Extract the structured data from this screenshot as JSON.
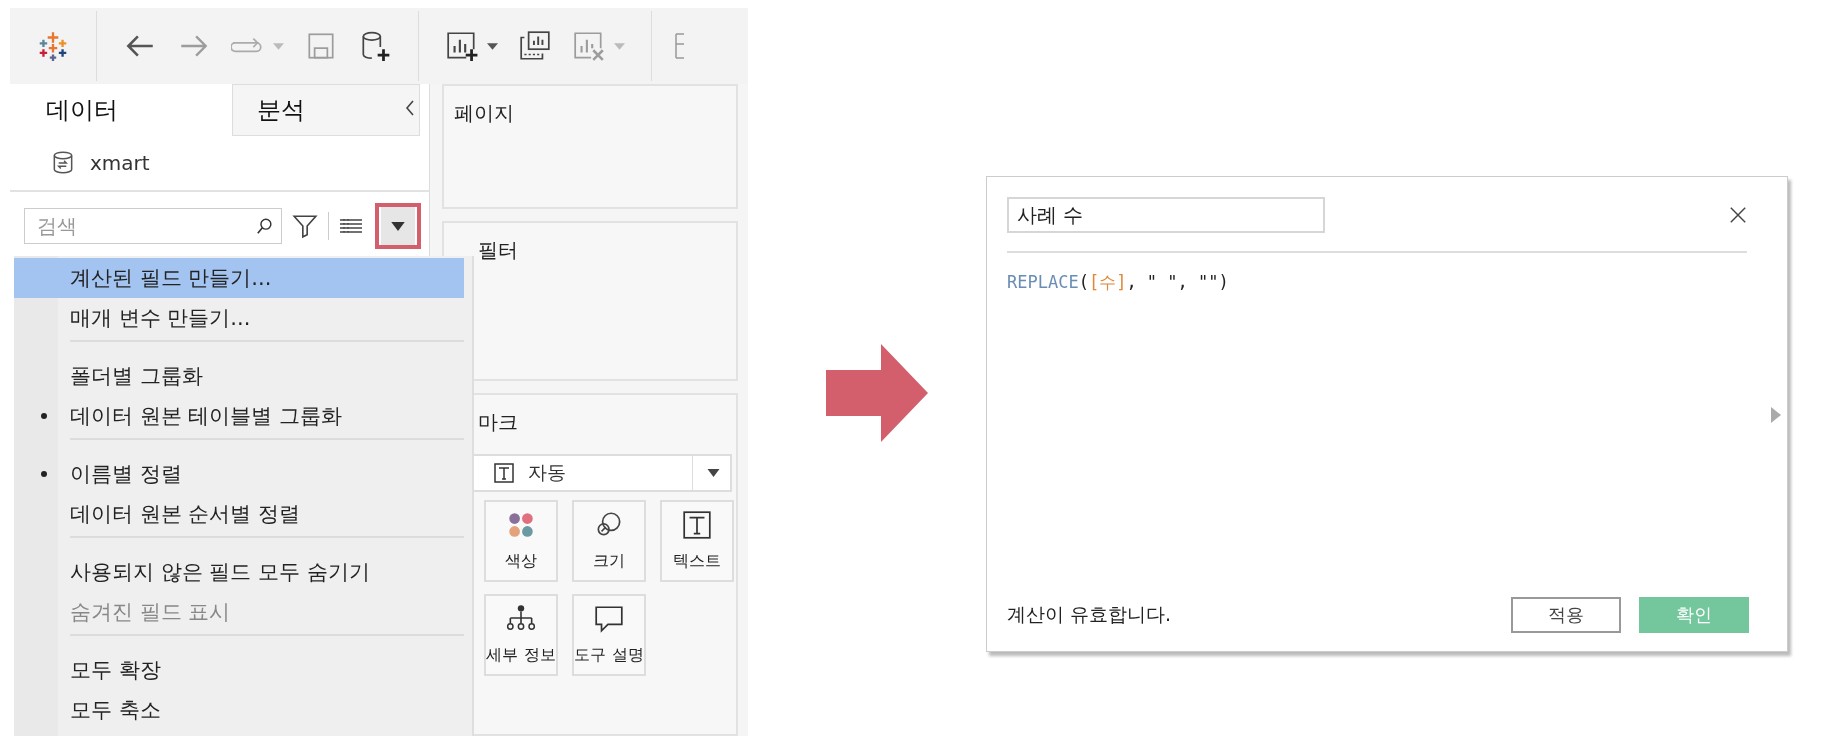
{
  "toolbar": [
    {
      "kind": "logo",
      "disabled": false,
      "caret": false
    },
    {
      "kind": "back",
      "disabled": false,
      "caret": false
    },
    {
      "kind": "forward",
      "disabled": true,
      "caret": false
    },
    {
      "kind": "redo",
      "disabled": true,
      "caret": true
    },
    {
      "kind": "save",
      "disabled": true,
      "caret": false
    },
    {
      "kind": "new-datasource",
      "disabled": false,
      "caret": false
    },
    {
      "kind": "new-sheet",
      "disabled": false,
      "caret": true
    },
    {
      "kind": "duplicate-sheet",
      "disabled": false,
      "caret": false
    },
    {
      "kind": "clear-sheet",
      "disabled": true,
      "caret": true
    }
  ],
  "side_tabs": [
    {
      "label": "데이터",
      "selected": true
    },
    {
      "label": "분석",
      "selected": false
    }
  ],
  "datasource": "xmart",
  "search": {
    "placeholder": "검색"
  },
  "menu": {
    "groups": [
      [
        {
          "label": "계산된 필드 만들기...",
          "selected": true,
          "checked": false,
          "disabled": false
        },
        {
          "label": "매개 변수 만들기...",
          "selected": false,
          "checked": false,
          "disabled": false
        }
      ],
      [
        {
          "label": "폴더별 그룹화",
          "selected": false,
          "checked": false,
          "disabled": false
        },
        {
          "label": "데이터 원본 테이블별 그룹화",
          "selected": false,
          "checked": true,
          "disabled": false
        }
      ],
      [
        {
          "label": "이름별 정렬",
          "selected": false,
          "checked": true,
          "disabled": false
        },
        {
          "label": "데이터 원본 순서별 정렬",
          "selected": false,
          "checked": false,
          "disabled": false
        }
      ],
      [
        {
          "label": "사용되지 않은 필드 모두 숨기기",
          "selected": false,
          "checked": false,
          "disabled": false
        },
        {
          "label": "숨겨진 필드 표시",
          "selected": false,
          "checked": false,
          "disabled": true
        }
      ],
      [
        {
          "label": "모두 확장",
          "selected": false,
          "checked": false,
          "disabled": false
        },
        {
          "label": "모두 축소",
          "selected": false,
          "checked": false,
          "disabled": false
        }
      ]
    ]
  },
  "cards": {
    "pages": "페이지",
    "filters": "필터",
    "marks": "마크"
  },
  "mark_type": "자동",
  "mark_tiles": [
    {
      "kind": "color",
      "label": "색상"
    },
    {
      "kind": "size",
      "label": "크기"
    },
    {
      "kind": "text",
      "label": "텍스트"
    },
    {
      "kind": "detail",
      "label": "세부 정보"
    },
    {
      "kind": "tooltip",
      "label": "도구 설명"
    }
  ],
  "dialog": {
    "name": "사례 수",
    "formula": [
      {
        "kind": "function",
        "text": "REPLACE"
      },
      {
        "kind": "plain",
        "text": "("
      },
      {
        "kind": "field",
        "text": "[수]"
      },
      {
        "kind": "plain",
        "text": ", \" \", \"\")"
      }
    ],
    "status": "계산이 유효합니다.",
    "buttons": [
      {
        "label": "적용",
        "kind": "secondary"
      },
      {
        "label": "확인",
        "kind": "primary"
      }
    ]
  }
}
